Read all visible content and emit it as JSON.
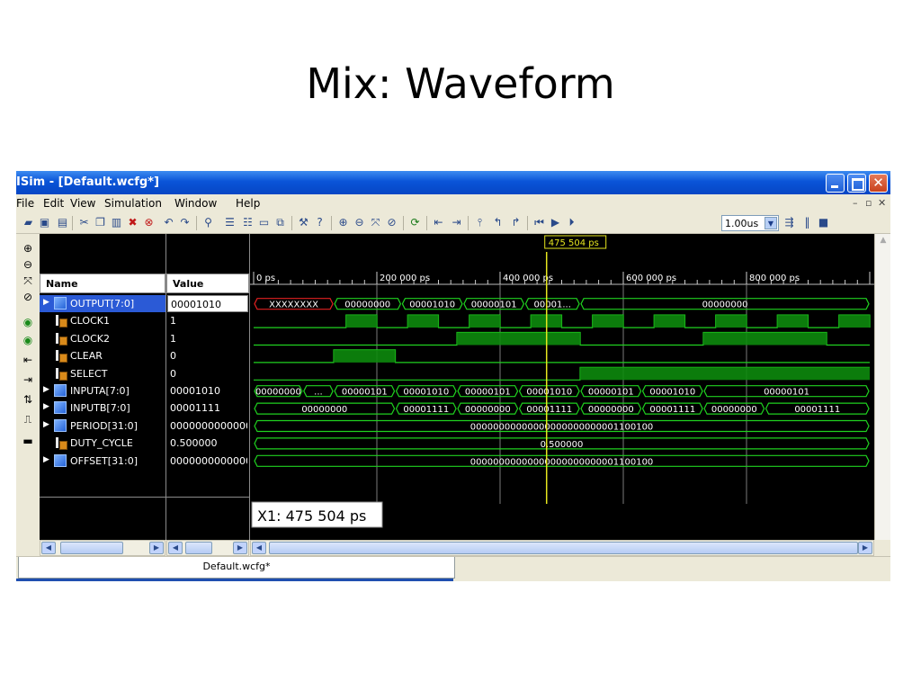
{
  "slide_title": "Mix: Waveform",
  "window": {
    "title": "ISim - [Default.wcfg*]",
    "tab_label": "Default.wcfg*",
    "zoom_value": "1.00us"
  },
  "menu": [
    "File",
    "Edit",
    "View",
    "Simulation",
    "Window",
    "Help"
  ],
  "columns": {
    "name": "Name",
    "value": "Value"
  },
  "signals": [
    {
      "name": "OUTPUT[7:0]",
      "value": "00001010",
      "kind": "bus",
      "expandable": true,
      "selected": true
    },
    {
      "name": "CLOCK1",
      "value": "1",
      "kind": "bit",
      "expandable": false
    },
    {
      "name": "CLOCK2",
      "value": "1",
      "kind": "bit",
      "expandable": false
    },
    {
      "name": "CLEAR",
      "value": "0",
      "kind": "bit",
      "expandable": false
    },
    {
      "name": "SELECT",
      "value": "0",
      "kind": "bit",
      "expandable": false
    },
    {
      "name": "INPUTA[7:0]",
      "value": "00001010",
      "kind": "bus",
      "expandable": true
    },
    {
      "name": "INPUTB[7:0]",
      "value": "00001111",
      "kind": "bus",
      "expandable": true
    },
    {
      "name": "PERIOD[31:0]",
      "value": "0000000000000",
      "kind": "bus",
      "expandable": true
    },
    {
      "name": "DUTY_CYCLE",
      "value": "0.500000",
      "kind": "bit",
      "expandable": false
    },
    {
      "name": "OFFSET[31:0]",
      "value": "0000000000000",
      "kind": "bus",
      "expandable": true
    }
  ],
  "timeline": {
    "ticks": [
      "0 ps",
      "200 000 ps",
      "400 000 ps",
      "600 000 ps",
      "800 000 ps"
    ],
    "cursor_label": "475 504 ps",
    "cursor_readout": "X1: 475 504 ps",
    "wave_labels": {
      "output": [
        "XXXXXXXX",
        "00000000",
        "00001010",
        "00000101",
        "00001...",
        "00000000"
      ],
      "inputa": [
        "00000000",
        "...",
        "00000101",
        "00001010",
        "00000101",
        "00001010",
        "00000101",
        "00001010",
        "00000101"
      ],
      "inputb": [
        "00000000",
        "00001111",
        "00000000",
        "00001111",
        "00000000",
        "00001111",
        "00000000",
        "00001111"
      ],
      "period": "00000000000000000000000001100100",
      "duty_cycle": "0.500000",
      "offset": "00000000000000000000000001100100"
    }
  }
}
